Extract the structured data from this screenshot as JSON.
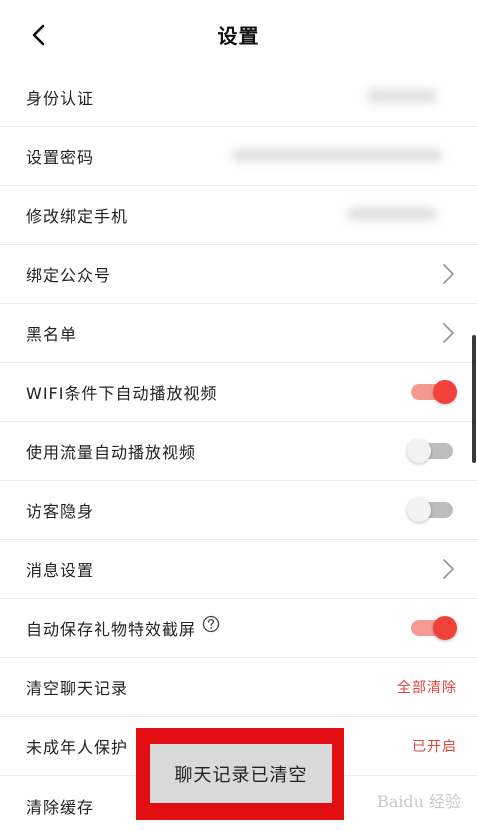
{
  "header": {
    "back_icon": "chevron-left-icon",
    "title": "设置"
  },
  "items": [
    {
      "label": "身份认证",
      "type": "blurred"
    },
    {
      "label": "设置密码",
      "type": "blurred"
    },
    {
      "label": "修改绑定手机",
      "type": "blurred"
    },
    {
      "label": "绑定公众号",
      "type": "nav"
    },
    {
      "label": "黑名单",
      "type": "nav"
    },
    {
      "label": "WIFI条件下自动播放视频",
      "type": "toggle",
      "on": true
    },
    {
      "label": "使用流量自动播放视频",
      "type": "toggle",
      "on": false
    },
    {
      "label": "访客隐身",
      "type": "toggle",
      "on": false
    },
    {
      "label": "消息设置",
      "type": "nav"
    },
    {
      "label": "自动保存礼物特效截屏",
      "type": "toggle",
      "on": true,
      "help_icon": "question-circle-icon"
    },
    {
      "label": "清空聊天记录",
      "type": "action",
      "action_text": "全部清除"
    },
    {
      "label": "未成年人保护",
      "type": "status",
      "status_text": "已开启"
    },
    {
      "label": "清除缓存",
      "type": "plain"
    }
  ],
  "toast": {
    "text": "聊天记录已清空"
  },
  "watermark": "Baidu 经验",
  "colors": {
    "accent": "#f0423a",
    "status_text": "#e0453c",
    "highlight_frame": "#e20e12"
  }
}
